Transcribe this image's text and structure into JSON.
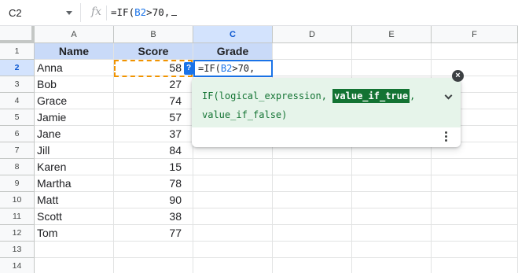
{
  "formula_bar": {
    "cell_ref": "C2",
    "fx_label": "fx",
    "formula_prefix": "=IF(",
    "formula_ref": "B2",
    "formula_suffix": ">70,"
  },
  "columns": [
    "A",
    "B",
    "C",
    "D",
    "E",
    "F"
  ],
  "row_numbers": [
    "1",
    "2",
    "3",
    "4",
    "5",
    "6",
    "7",
    "8",
    "9",
    "10",
    "11",
    "12",
    "13",
    "14"
  ],
  "headers": {
    "name": "Name",
    "score": "Score",
    "grade": "Grade"
  },
  "rows": [
    {
      "name": "Anna",
      "score": "58"
    },
    {
      "name": "Bob",
      "score": "27"
    },
    {
      "name": "Grace",
      "score": "74"
    },
    {
      "name": "Jamie",
      "score": "57"
    },
    {
      "name": "Jane",
      "score": "37"
    },
    {
      "name": "Jill",
      "score": "84"
    },
    {
      "name": "Karen",
      "score": "15"
    },
    {
      "name": "Martha",
      "score": "78"
    },
    {
      "name": "Matt",
      "score": "90"
    },
    {
      "name": "Scott",
      "score": "38"
    },
    {
      "name": "Tom",
      "score": "77"
    }
  ],
  "editor": {
    "badge": "?",
    "prefix": "=IF(",
    "ref": "B2",
    "suffix": ">70,"
  },
  "formula_help": {
    "part1": "IF(logical_expression, ",
    "active_arg": "value_if_true",
    "part2": ",",
    "part3": "value_if_false)",
    "close_icon": "×",
    "expand_icon": "chevron-down-icon",
    "more_icon": "more-vert-icon"
  },
  "colors": {
    "accent": "#1a73e8",
    "header_fill": "#c9daf8",
    "reference_dash": "#f09300",
    "help_bg": "#e6f4ea",
    "help_text": "#137333"
  }
}
